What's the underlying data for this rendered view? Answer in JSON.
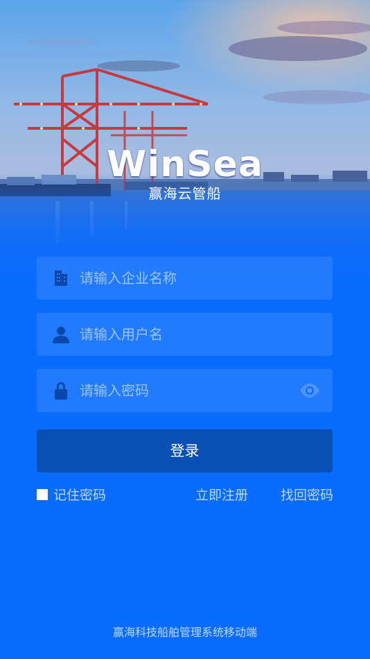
{
  "brand": {
    "logo_text": "WinSea",
    "subtitle": "赢海云管船"
  },
  "form": {
    "company": {
      "placeholder": "请输入企业名称",
      "value": "",
      "icon": "building-icon"
    },
    "username": {
      "placeholder": "请输入用户名",
      "value": "",
      "icon": "user-icon"
    },
    "password": {
      "placeholder": "请输入密码",
      "value": "",
      "icon": "lock-icon",
      "toggle_icon": "eye-icon"
    },
    "login_label": "登录"
  },
  "options": {
    "remember_label": "记住密码",
    "remember_checked": false,
    "register_label": "立即注册",
    "forgot_label": "找回密码"
  },
  "footer": {
    "text": "赢海科技船舶管理系统移动端"
  },
  "colors": {
    "background": "#0a6cff",
    "button": "#0a4fb3",
    "text": "#ffffff"
  }
}
